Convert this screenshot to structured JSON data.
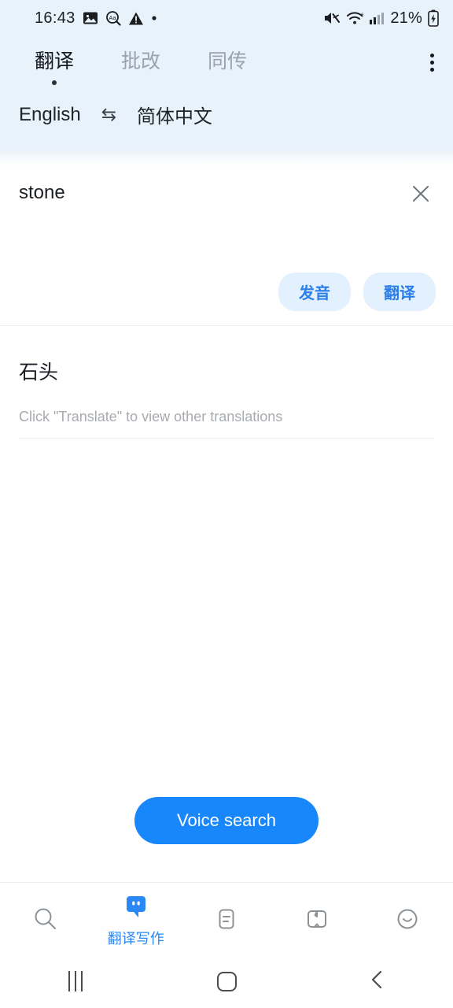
{
  "status_bar": {
    "time": "16:43",
    "battery_percent": "21%",
    "left_icons": [
      "image-icon",
      "text-search-icon",
      "warning-icon",
      "dot-icon"
    ],
    "right_icons": [
      "mute-icon",
      "wifi-icon",
      "cellular-signal-icon",
      "battery-icon"
    ]
  },
  "header": {
    "tabs": [
      {
        "label": "翻译",
        "active": true
      },
      {
        "label": "批改",
        "active": false
      },
      {
        "label": "同传",
        "active": false
      }
    ],
    "overflow_menu": "more-options"
  },
  "language_bar": {
    "source": "English",
    "swap_icon": "⇆",
    "target": "简体中文"
  },
  "input": {
    "value": "stone",
    "placeholder": "",
    "clear_label": "✕",
    "pronounce_button": "发音",
    "translate_button": "翻译"
  },
  "result": {
    "translation": "石头",
    "hint": "Click \"Translate\" to view other translations"
  },
  "voice": {
    "button_label": "Voice search"
  },
  "bottom_nav": {
    "items": [
      {
        "icon": "search-icon",
        "label": "",
        "active": false
      },
      {
        "icon": "chat-bubble-icon",
        "label": "翻译写作",
        "active": true
      },
      {
        "icon": "document-icon",
        "label": "",
        "active": false
      },
      {
        "icon": "book-icon",
        "label": "",
        "active": false
      },
      {
        "icon": "smiley-icon",
        "label": "",
        "active": false
      }
    ]
  },
  "android_nav": {
    "recents": "recent-apps",
    "home": "home",
    "back": "back"
  },
  "colors": {
    "header_bg": "#e8f2fb",
    "accent_blue": "#1787fb",
    "pill_bg": "#e3f0fd",
    "pill_text": "#2a7fea",
    "inactive_gray": "#9aa3ad"
  }
}
